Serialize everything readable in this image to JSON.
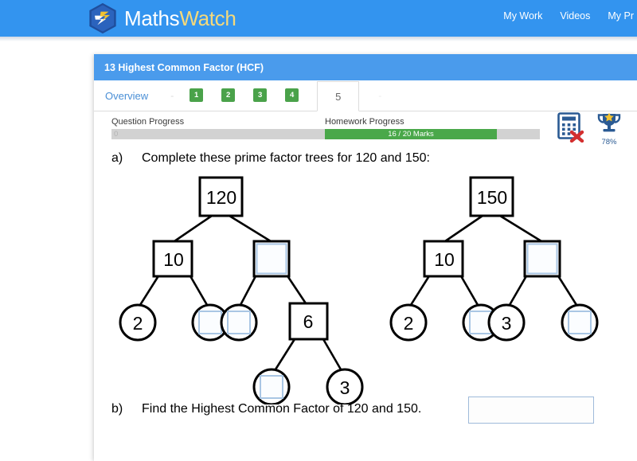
{
  "header": {
    "logo": {
      "icon": "mathswatch-bolt-logo",
      "text_primary": "Maths",
      "text_secondary": "Watch"
    },
    "nav": [
      {
        "label": "My Work"
      },
      {
        "label": "Videos"
      },
      {
        "label": "My Pr"
      }
    ],
    "brand_color": "#3394ef",
    "accent_color": "#f5d97a"
  },
  "card": {
    "title": "13 Highest Common Factor (HCF)",
    "title_bg": "#4a9bec"
  },
  "tabs": {
    "overview_label": "Overview",
    "separator": "-",
    "numbered": [
      "1",
      "2",
      "3",
      "4"
    ],
    "active": "5",
    "trailing": "-",
    "badge_color": "#4aa24a"
  },
  "progress": {
    "question": {
      "label": "Question Progress",
      "value_text": "0",
      "percent": 0
    },
    "homework": {
      "label": "Homework Progress",
      "value_text": "16 / 20 Marks",
      "percent": 80,
      "fill_color": "#4aa84a"
    }
  },
  "status_icons": {
    "calculator": {
      "name": "calculator-not-allowed-icon",
      "cross_color": "#d32f2f"
    },
    "trophy": {
      "name": "trophy-icon",
      "percent_label": "78%"
    }
  },
  "question": {
    "part_a": {
      "label": "a)",
      "text": "Complete these prime factor trees for 120 and 150:"
    },
    "part_b": {
      "label": "b)",
      "text": "Find the Highest Common Factor of 120 and 150.",
      "answer_value": "",
      "answer_placeholder": ""
    },
    "trees": [
      {
        "name": "prime-factor-tree-120",
        "root": {
          "shape": "square",
          "value": "120",
          "filled": true
        },
        "nodes": [
          {
            "id": "t1-l1",
            "shape": "square",
            "value": "10",
            "filled": true
          },
          {
            "id": "t1-r1",
            "shape": "square",
            "value": "",
            "filled": false
          },
          {
            "id": "t1-l1a",
            "shape": "circle",
            "value": "2",
            "filled": true
          },
          {
            "id": "t1-l1b",
            "shape": "circle",
            "value": "",
            "filled": false
          },
          {
            "id": "t1-r1a",
            "shape": "circle",
            "value": "",
            "filled": false
          },
          {
            "id": "t1-r1b",
            "shape": "square",
            "value": "6",
            "filled": true
          },
          {
            "id": "t1-r1b-a",
            "shape": "circle",
            "value": "",
            "filled": false
          },
          {
            "id": "t1-r1b-b",
            "shape": "circle",
            "value": "3",
            "filled": true
          }
        ]
      },
      {
        "name": "prime-factor-tree-150",
        "root": {
          "shape": "square",
          "value": "150",
          "filled": true
        },
        "nodes": [
          {
            "id": "t2-l1",
            "shape": "square",
            "value": "10",
            "filled": true
          },
          {
            "id": "t2-r1",
            "shape": "square",
            "value": "",
            "filled": false
          },
          {
            "id": "t2-l1a",
            "shape": "circle",
            "value": "2",
            "filled": true
          },
          {
            "id": "t2-l1b",
            "shape": "circle",
            "value": "",
            "filled": false
          },
          {
            "id": "t2-r1a",
            "shape": "circle",
            "value": "3",
            "filled": true
          },
          {
            "id": "t2-r1b",
            "shape": "circle",
            "value": "",
            "filled": false
          }
        ]
      }
    ]
  }
}
